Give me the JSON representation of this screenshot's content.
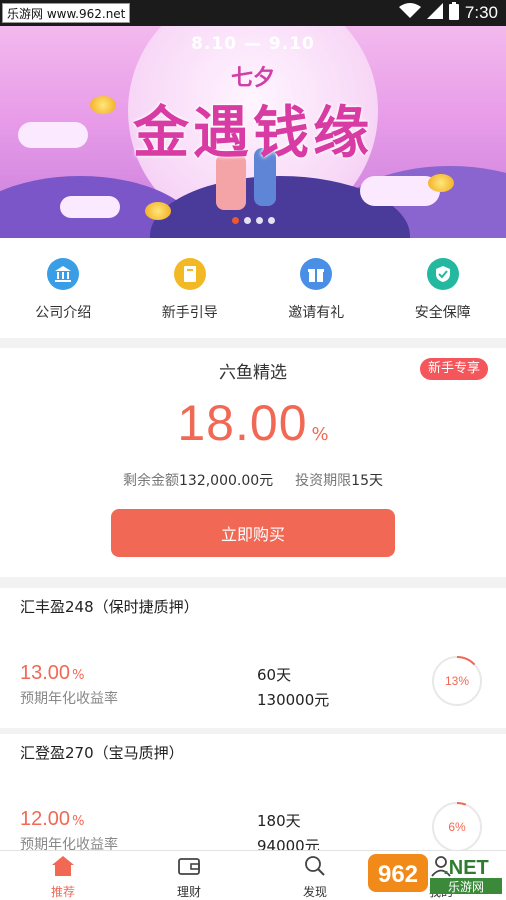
{
  "status_bar": {
    "time": "7:30",
    "watermark": "乐游网 www.962.net",
    "icons": [
      "wifi-icon",
      "signal-icon",
      "battery-icon"
    ]
  },
  "banner": {
    "date_range": "8.10 — 9.10",
    "subtitle": "七夕",
    "title": "金遇钱缘",
    "dots": [
      true,
      false,
      false,
      false
    ]
  },
  "quick_nav": [
    {
      "label": "公司介绍",
      "icon": "bank-icon",
      "color": "#3a9ee6"
    },
    {
      "label": "新手引导",
      "icon": "book-icon",
      "color": "#f2b924"
    },
    {
      "label": "邀请有礼",
      "icon": "gift-icon",
      "color": "#4a8fe6"
    },
    {
      "label": "安全保障",
      "icon": "shield-icon",
      "color": "#24b8a0"
    }
  ],
  "featured": {
    "name": "六鱼精选",
    "badge": "新手专享",
    "rate": "18.00",
    "rate_unit": "%",
    "remaining_label": "剩余金额",
    "remaining_value": "132,000.00元",
    "term_label": "投资期限",
    "term_value": "15天",
    "buy_label": "立即购买"
  },
  "products": [
    {
      "title": "汇丰盈248（保时捷质押）",
      "rate": "13.00",
      "rate_unit": "%",
      "rate_label": "预期年化收益率",
      "term": "60天",
      "amount": "130000元",
      "progress_label": "13%",
      "progress": 0.13
    },
    {
      "title": "汇登盈270（宝马质押）",
      "rate": "12.00",
      "rate_unit": "%",
      "rate_label": "预期年化收益率",
      "term": "180天",
      "amount": "94000元",
      "progress_label": "6%",
      "progress": 0.06
    }
  ],
  "bottom_nav": [
    {
      "label": "推荐",
      "icon": "home-icon",
      "active": true
    },
    {
      "label": "理财",
      "icon": "wallet-icon",
      "active": false
    },
    {
      "label": "发现",
      "icon": "search-icon",
      "active": false
    },
    {
      "label": "我的",
      "icon": "user-icon",
      "active": false
    }
  ],
  "corner_watermark": "962.NET 乐游网",
  "colors": {
    "accent": "#f16955",
    "badge": "#f4565b"
  }
}
